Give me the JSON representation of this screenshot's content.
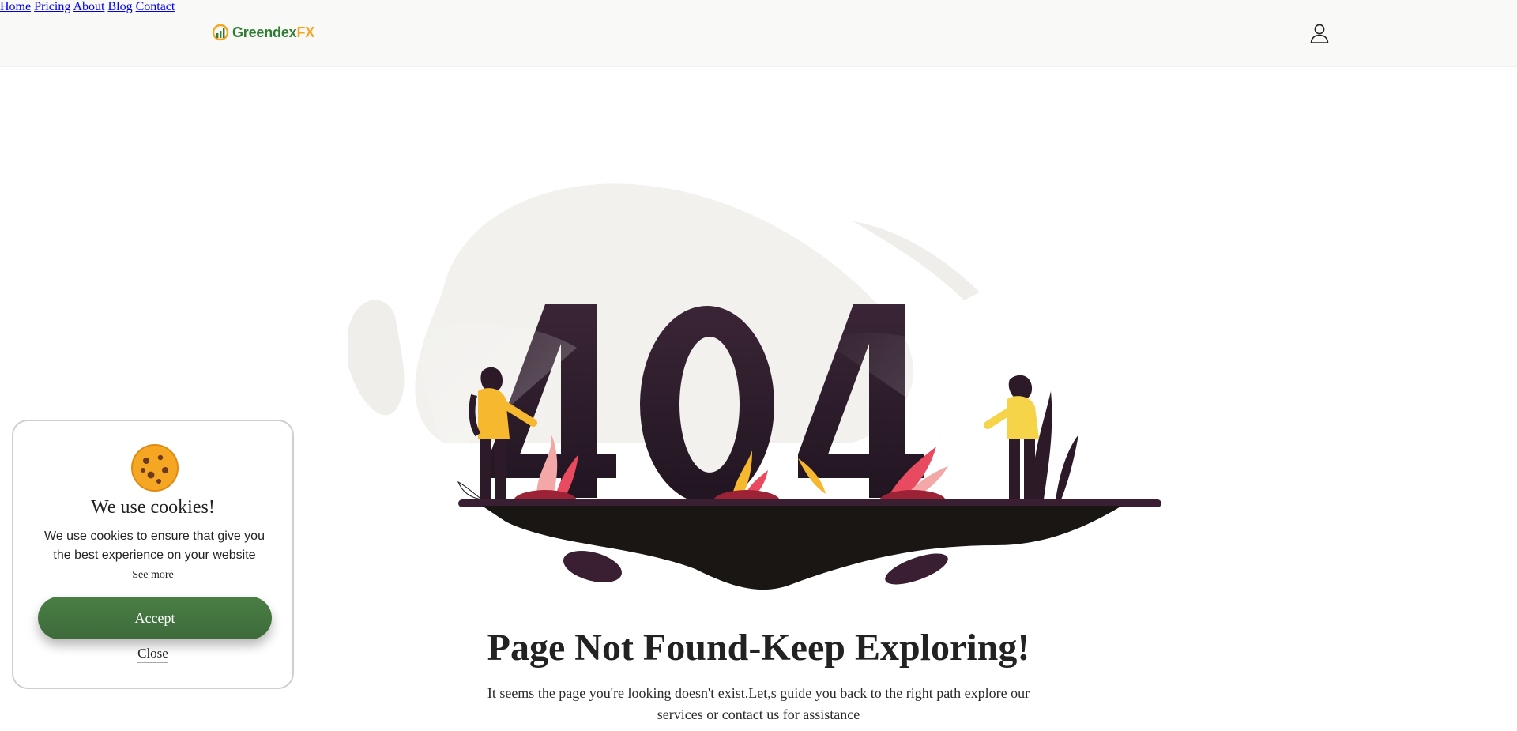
{
  "brand": {
    "name_main": "Greendex",
    "name_accent": "FX"
  },
  "nav": {
    "items": [
      {
        "label": "Home"
      },
      {
        "label": "Pricing"
      },
      {
        "label": "About"
      },
      {
        "label": "Blog"
      },
      {
        "label": "Contact"
      }
    ]
  },
  "hero": {
    "big_number": "404",
    "title": "Page Not Found-Keep Exploring!",
    "subtitle": "It seems the page you're looking doesn't exist.Let,s guide you back to the right path explore our services or contact us for assistance"
  },
  "cookie": {
    "title": "We use cookies!",
    "body": "We use cookies to ensure that give you the best experience on your website",
    "see_more": "See more",
    "accept_label": "Accept",
    "close_label": "Close"
  },
  "colors": {
    "brand_green": "#2e7d32",
    "brand_orange": "#f5a623",
    "accept_green": "#4a7e45",
    "dark_plum": "#2c1a28"
  },
  "icons": [
    "logo-icon",
    "user-icon",
    "cookie-icon"
  ]
}
